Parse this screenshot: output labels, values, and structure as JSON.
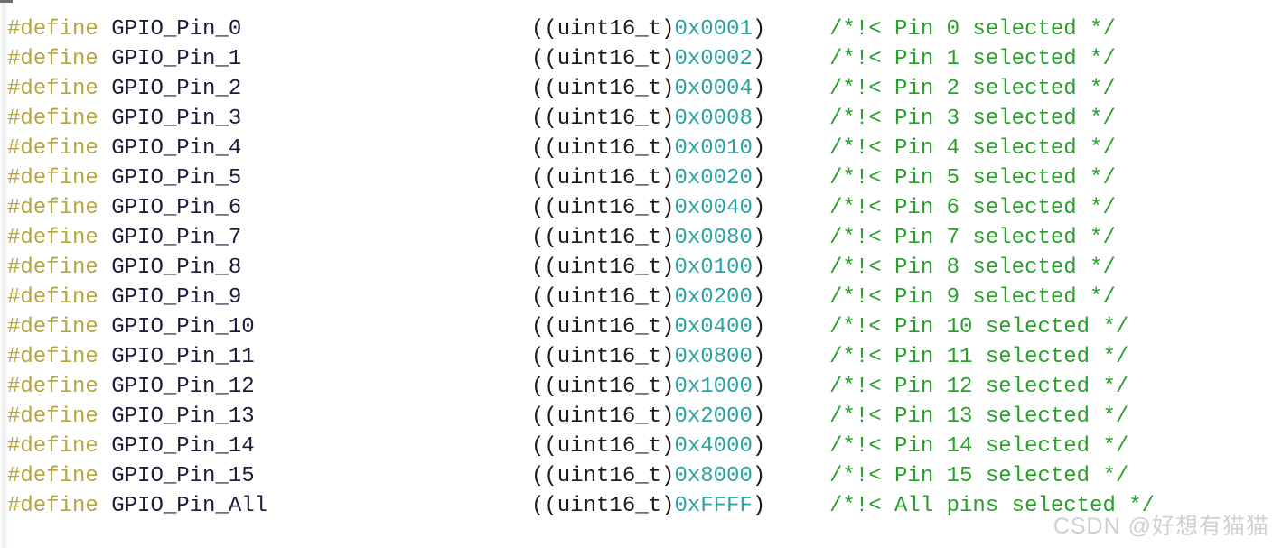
{
  "editor": {
    "language": "c",
    "background_color": "#ffffff",
    "gutter_color": "#eeeeee",
    "font_size_px": 24,
    "line_height_px": 33,
    "syntax_colors": {
      "preprocessor_directive": "#b5a642",
      "identifier": "#1b1b3a",
      "cast_type": "#1b1b1b",
      "number_literal": "#2ba3a3",
      "punctuation": "#1b1b1b",
      "comment": "#2aa02c"
    }
  },
  "watermark": {
    "text": "CSDN @好想有猫猫",
    "color": "#d0d0d0"
  },
  "code": {
    "lines": [
      {
        "directive": "#define",
        "identifier": "GPIO_Pin_0",
        "cast": "((uint16_t)",
        "number": "0x0001",
        "close_paren": ")",
        "comment": "/*!< Pin 0 selected */"
      },
      {
        "directive": "#define",
        "identifier": "GPIO_Pin_1",
        "cast": "((uint16_t)",
        "number": "0x0002",
        "close_paren": ")",
        "comment": "/*!< Pin 1 selected */"
      },
      {
        "directive": "#define",
        "identifier": "GPIO_Pin_2",
        "cast": "((uint16_t)",
        "number": "0x0004",
        "close_paren": ")",
        "comment": "/*!< Pin 2 selected */"
      },
      {
        "directive": "#define",
        "identifier": "GPIO_Pin_3",
        "cast": "((uint16_t)",
        "number": "0x0008",
        "close_paren": ")",
        "comment": "/*!< Pin 3 selected */"
      },
      {
        "directive": "#define",
        "identifier": "GPIO_Pin_4",
        "cast": "((uint16_t)",
        "number": "0x0010",
        "close_paren": ")",
        "comment": "/*!< Pin 4 selected */"
      },
      {
        "directive": "#define",
        "identifier": "GPIO_Pin_5",
        "cast": "((uint16_t)",
        "number": "0x0020",
        "close_paren": ")",
        "comment": "/*!< Pin 5 selected */"
      },
      {
        "directive": "#define",
        "identifier": "GPIO_Pin_6",
        "cast": "((uint16_t)",
        "number": "0x0040",
        "close_paren": ")",
        "comment": "/*!< Pin 6 selected */"
      },
      {
        "directive": "#define",
        "identifier": "GPIO_Pin_7",
        "cast": "((uint16_t)",
        "number": "0x0080",
        "close_paren": ")",
        "comment": "/*!< Pin 7 selected */"
      },
      {
        "directive": "#define",
        "identifier": "GPIO_Pin_8",
        "cast": "((uint16_t)",
        "number": "0x0100",
        "close_paren": ")",
        "comment": "/*!< Pin 8 selected */"
      },
      {
        "directive": "#define",
        "identifier": "GPIO_Pin_9",
        "cast": "((uint16_t)",
        "number": "0x0200",
        "close_paren": ")",
        "comment": "/*!< Pin 9 selected */"
      },
      {
        "directive": "#define",
        "identifier": "GPIO_Pin_10",
        "cast": "((uint16_t)",
        "number": "0x0400",
        "close_paren": ")",
        "comment": "/*!< Pin 10 selected */"
      },
      {
        "directive": "#define",
        "identifier": "GPIO_Pin_11",
        "cast": "((uint16_t)",
        "number": "0x0800",
        "close_paren": ")",
        "comment": "/*!< Pin 11 selected */"
      },
      {
        "directive": "#define",
        "identifier": "GPIO_Pin_12",
        "cast": "((uint16_t)",
        "number": "0x1000",
        "close_paren": ")",
        "comment": "/*!< Pin 12 selected */"
      },
      {
        "directive": "#define",
        "identifier": "GPIO_Pin_13",
        "cast": "((uint16_t)",
        "number": "0x2000",
        "close_paren": ")",
        "comment": "/*!< Pin 13 selected */"
      },
      {
        "directive": "#define",
        "identifier": "GPIO_Pin_14",
        "cast": "((uint16_t)",
        "number": "0x4000",
        "close_paren": ")",
        "comment": "/*!< Pin 14 selected */"
      },
      {
        "directive": "#define",
        "identifier": "GPIO_Pin_15",
        "cast": "((uint16_t)",
        "number": "0x8000",
        "close_paren": ")",
        "comment": "/*!< Pin 15 selected */"
      },
      {
        "directive": "#define",
        "identifier": "GPIO_Pin_All",
        "cast": "((uint16_t)",
        "number": "0xFFFF",
        "close_paren": ")",
        "comment": "/*!< All pins selected */"
      }
    ]
  }
}
